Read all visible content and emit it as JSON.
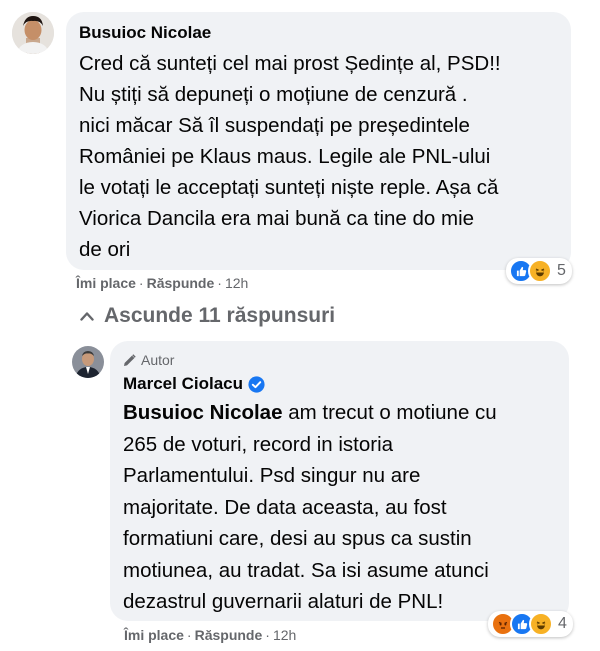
{
  "comment1": {
    "author": "Busuioc Nicolae",
    "lines": [
      "Cred că sunteți cel mai prost Ședințe al, PSD!!",
      "Nu știți să depuneți o moțiune de cenzură .",
      "nici măcar Să îl suspendați pe președintele",
      "României pe Klaus maus. Legile ale PNL-ului",
      "le votați le acceptați sunteți niște reple. Așa că",
      "Viorica Dancila era mai bună ca tine do mie",
      "de ori"
    ],
    "like_label": "Îmi place",
    "reply_label": "Răspunde",
    "time": "12h",
    "reaction_count": "5",
    "reaction_icons": [
      "like-icon",
      "haha-icon"
    ]
  },
  "replies_toggle": {
    "label": "Ascunde 11 răspunsuri",
    "icon": "chevron-up-icon"
  },
  "reply1": {
    "badge_label": "Autor",
    "badge_icon": "pencil-icon",
    "author": "Marcel Ciolacu",
    "verified_icon": "verified-icon",
    "mention": "Busuioc Nicolae",
    "first_line_rest": " am trecut o motiune cu",
    "lines": [
      "265 de voturi, record in istoria",
      "Parlamentului. Psd singur nu are",
      "majoritate. De data aceasta, au fost",
      "formatiuni care, desi au spus ca sustin",
      "motiunea, au tradat. Sa isi asume atunci",
      "dezastrul guvernarii alaturi de PNL!"
    ],
    "like_label": "Îmi place",
    "reply_label": "Răspunde",
    "time": "12h",
    "reaction_count": "4",
    "reaction_icons": [
      "angry-icon",
      "like-icon",
      "haha-icon"
    ]
  },
  "colors": {
    "bubble": "#f0f2f5",
    "meta": "#65676b",
    "like_blue": "#1877f2",
    "haha_yellow": "#f7b125",
    "angry_orange": "#e9710f"
  }
}
